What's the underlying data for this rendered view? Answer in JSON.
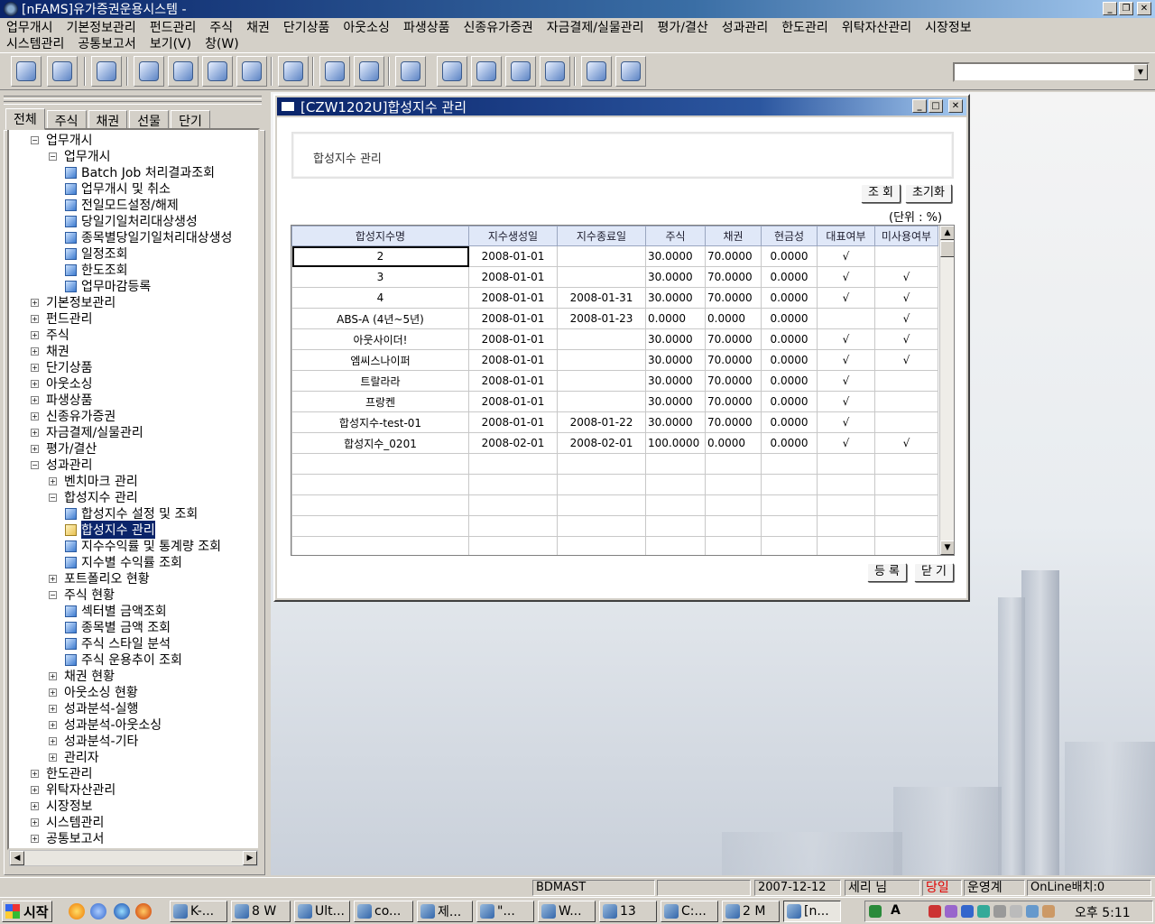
{
  "window": {
    "title": "[nFAMS]유가증권운용시스템 -"
  },
  "menu": {
    "row1": [
      "업무개시",
      "기본정보관리",
      "펀드관리",
      "주식",
      "채권",
      "단기상품",
      "아웃소싱",
      "파생상품",
      "신종유가증권",
      "자금결제/실물관리",
      "평가/결산",
      "성과관리",
      "한도관리",
      "위탁자산관리",
      "시장정보"
    ],
    "row2": [
      "시스템관리",
      "공통보고서",
      "보기(V)",
      "창(W)"
    ]
  },
  "toolbar": {
    "icons": [
      "lock-icon",
      "book-icon",
      "save-icon",
      "globe-icon",
      "chart-icon",
      "stack-icon",
      "clock-alert-icon",
      "database-icon",
      "timer-icon",
      "calendar-icon",
      "search-icon",
      "print-icon",
      "box-icon",
      "document-icon",
      "help-icon",
      "padlock-icon",
      "exit-icon"
    ],
    "combo_value": ""
  },
  "sidebar": {
    "tabs": [
      "전체",
      "주식",
      "채권",
      "선물",
      "단기"
    ],
    "active_tab": "전체",
    "tree": [
      {
        "label": "업무개시",
        "level": 0,
        "type": "folder",
        "expander": "⊟"
      },
      {
        "label": "업무개시",
        "level": 1,
        "type": "folder",
        "expander": "⊟"
      },
      {
        "label": "Batch Job 처리결과조회",
        "level": 2,
        "type": "doc"
      },
      {
        "label": "업무개시 및 취소",
        "level": 2,
        "type": "doc"
      },
      {
        "label": "전일모드설정/해제",
        "level": 2,
        "type": "doc"
      },
      {
        "label": "당일기일처리대상생성",
        "level": 2,
        "type": "doc"
      },
      {
        "label": "종목별당일기일처리대상생성",
        "level": 2,
        "type": "doc"
      },
      {
        "label": "일정조회",
        "level": 2,
        "type": "doc"
      },
      {
        "label": "한도조회",
        "level": 2,
        "type": "doc"
      },
      {
        "label": "업무마감등록",
        "level": 2,
        "type": "doc"
      },
      {
        "label": "기본정보관리",
        "level": 0,
        "type": "folder",
        "expander": "⊞"
      },
      {
        "label": "펀드관리",
        "level": 0,
        "type": "folder",
        "expander": "⊞"
      },
      {
        "label": "주식",
        "level": 0,
        "type": "folder",
        "expander": "⊞"
      },
      {
        "label": "채권",
        "level": 0,
        "type": "folder",
        "expander": "⊞"
      },
      {
        "label": "단기상품",
        "level": 0,
        "type": "folder",
        "expander": "⊞"
      },
      {
        "label": "아웃소싱",
        "level": 0,
        "type": "folder",
        "expander": "⊞"
      },
      {
        "label": "파생상품",
        "level": 0,
        "type": "folder",
        "expander": "⊞"
      },
      {
        "label": "신종유가증권",
        "level": 0,
        "type": "folder",
        "expander": "⊞"
      },
      {
        "label": "자금결제/실물관리",
        "level": 0,
        "type": "folder",
        "expander": "⊞"
      },
      {
        "label": "평가/결산",
        "level": 0,
        "type": "folder",
        "expander": "⊞"
      },
      {
        "label": "성과관리",
        "level": 0,
        "type": "folder",
        "expander": "⊟"
      },
      {
        "label": "벤치마크 관리",
        "level": 1,
        "type": "folder",
        "expander": "⊞"
      },
      {
        "label": "합성지수 관리",
        "level": 1,
        "type": "folder",
        "expander": "⊟"
      },
      {
        "label": "합성지수 설정 및 조회",
        "level": 2,
        "type": "doc"
      },
      {
        "label": "합성지수 관리",
        "level": 2,
        "type": "doc",
        "selected": true
      },
      {
        "label": "지수수익률 및 통계량 조회",
        "level": 2,
        "type": "doc"
      },
      {
        "label": "지수별 수익률 조회",
        "level": 2,
        "type": "doc"
      },
      {
        "label": "포트폴리오 현황",
        "level": 1,
        "type": "folder",
        "expander": "⊞"
      },
      {
        "label": "주식 현황",
        "level": 1,
        "type": "folder",
        "expander": "⊟"
      },
      {
        "label": "섹터별 금액조회",
        "level": 2,
        "type": "doc"
      },
      {
        "label": "종목별 금액 조회",
        "level": 2,
        "type": "doc"
      },
      {
        "label": "주식 스타일 분석",
        "level": 2,
        "type": "doc"
      },
      {
        "label": "주식 운용추이 조회",
        "level": 2,
        "type": "doc"
      },
      {
        "label": "채권 현황",
        "level": 1,
        "type": "folder",
        "expander": "⊞"
      },
      {
        "label": "아웃소싱 현황",
        "level": 1,
        "type": "folder",
        "expander": "⊞"
      },
      {
        "label": "성과분석-실행",
        "level": 1,
        "type": "folder",
        "expander": "⊞"
      },
      {
        "label": "성과분석-아웃소싱",
        "level": 1,
        "type": "folder",
        "expander": "⊞"
      },
      {
        "label": "성과분석-기타",
        "level": 1,
        "type": "folder",
        "expander": "⊞"
      },
      {
        "label": "관리자",
        "level": 1,
        "type": "folder",
        "expander": "⊞"
      },
      {
        "label": "한도관리",
        "level": 0,
        "type": "folder",
        "expander": "⊞"
      },
      {
        "label": "위탁자산관리",
        "level": 0,
        "type": "folder",
        "expander": "⊞"
      },
      {
        "label": "시장정보",
        "level": 0,
        "type": "folder",
        "expander": "⊞"
      },
      {
        "label": "시스템관리",
        "level": 0,
        "type": "folder",
        "expander": "⊞"
      },
      {
        "label": "공통보고서",
        "level": 0,
        "type": "folder",
        "expander": "⊞"
      }
    ]
  },
  "child_window": {
    "title": "[CZW1202U]합성지수 관리",
    "header_label": "합성지수 관리",
    "buttons": {
      "query": "조 회",
      "reset": "초기화",
      "register": "등 록",
      "close": "닫 기"
    },
    "unit": "(단위 : %)",
    "columns": [
      "합성지수명",
      "지수생성일",
      "지수종료일",
      "주식",
      "채권",
      "현금성",
      "대표여부",
      "미사용여부"
    ],
    "rows": [
      [
        "2",
        "2008-01-01",
        "",
        "30.0000",
        "70.0000",
        "0.0000",
        "√",
        ""
      ],
      [
        "3",
        "2008-01-01",
        "",
        "30.0000",
        "70.0000",
        "0.0000",
        "√",
        "√"
      ],
      [
        "4",
        "2008-01-01",
        "2008-01-31",
        "30.0000",
        "70.0000",
        "0.0000",
        "√",
        "√"
      ],
      [
        "ABS-A (4년~5년)",
        "2008-01-01",
        "2008-01-23",
        "0.0000",
        "0.0000",
        "0.0000",
        "",
        "√"
      ],
      [
        "아웃사이더!",
        "2008-01-01",
        "",
        "30.0000",
        "70.0000",
        "0.0000",
        "√",
        "√"
      ],
      [
        "엠씨스나이퍼",
        "2008-01-01",
        "",
        "30.0000",
        "70.0000",
        "0.0000",
        "√",
        "√"
      ],
      [
        "트랄라라",
        "2008-01-01",
        "",
        "30.0000",
        "70.0000",
        "0.0000",
        "√",
        ""
      ],
      [
        "프랑켄",
        "2008-01-01",
        "",
        "30.0000",
        "70.0000",
        "0.0000",
        "√",
        ""
      ],
      [
        "합성지수-test-01",
        "2008-01-01",
        "2008-01-22",
        "30.0000",
        "70.0000",
        "0.0000",
        "√",
        ""
      ],
      [
        "합성지수_0201",
        "2008-02-01",
        "2008-02-01",
        "100.0000",
        "0.0000",
        "0.0000",
        "√",
        "√"
      ],
      [
        "",
        "",
        "",
        "",
        "",
        "",
        "",
        ""
      ],
      [
        "",
        "",
        "",
        "",
        "",
        "",
        "",
        ""
      ],
      [
        "",
        "",
        "",
        "",
        "",
        "",
        "",
        ""
      ],
      [
        "",
        "",
        "",
        "",
        "",
        "",
        "",
        ""
      ],
      [
        "",
        "",
        "",
        "",
        "",
        "",
        "",
        ""
      ]
    ]
  },
  "statusbar": {
    "db": "BDMAST",
    "empty": "",
    "date": "2007-12-12",
    "user": "세리 님",
    "day_type": "당일",
    "mode": "운영계",
    "batch": "OnLine배치:0"
  },
  "taskbar": {
    "start": "시작",
    "tasks": [
      "K-...",
      "8 W",
      "Ult...",
      "co...",
      "제...",
      "\"...",
      "W...",
      "13",
      "C:...",
      "2 M",
      "[n..."
    ],
    "clock": "오후 5:11",
    "tray_text": "A"
  }
}
